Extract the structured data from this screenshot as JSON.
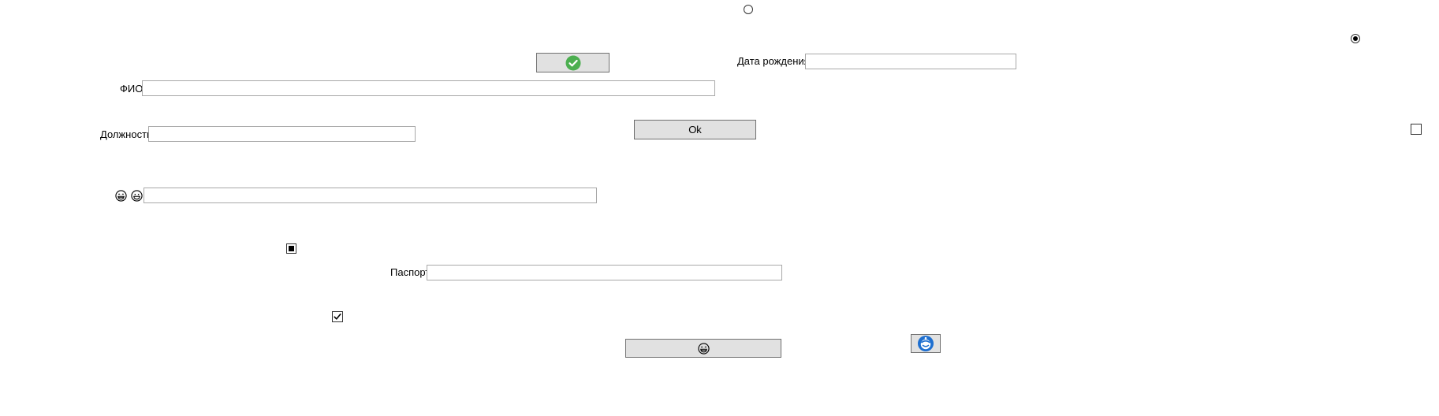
{
  "form": {
    "birth_date_label": "Дата рождения",
    "birth_date_value": "",
    "fio_label": "ФИО",
    "fio_value": "",
    "position_label": "Должность",
    "position_value": "",
    "passport_label": "Паспорт",
    "passport_value": "",
    "emoji_field_value": "",
    "ok_button_label": "Ok"
  },
  "controls": {
    "radio_top_checked": false,
    "radio_right_checked": true,
    "checkbox_right_checked": false,
    "checkbox_indeterminate_state": "indeterminate",
    "checkbox_checked": true
  },
  "icons": {
    "accept_button_icon": "green-check-circle-icon",
    "emoji_laugh_icon": "grinning-face-icon",
    "emoji_smile_icon": "smiling-face-icon",
    "emoji_button_icon": "grinning-face-icon",
    "image_button_icon": "blue-refresh-icon"
  },
  "colors": {
    "button_bg": "#e1e1e1",
    "button_border": "#707070",
    "input_border": "#a8a8a8",
    "check_green": "#4caf50",
    "icon_blue": "#1e6fd0"
  }
}
